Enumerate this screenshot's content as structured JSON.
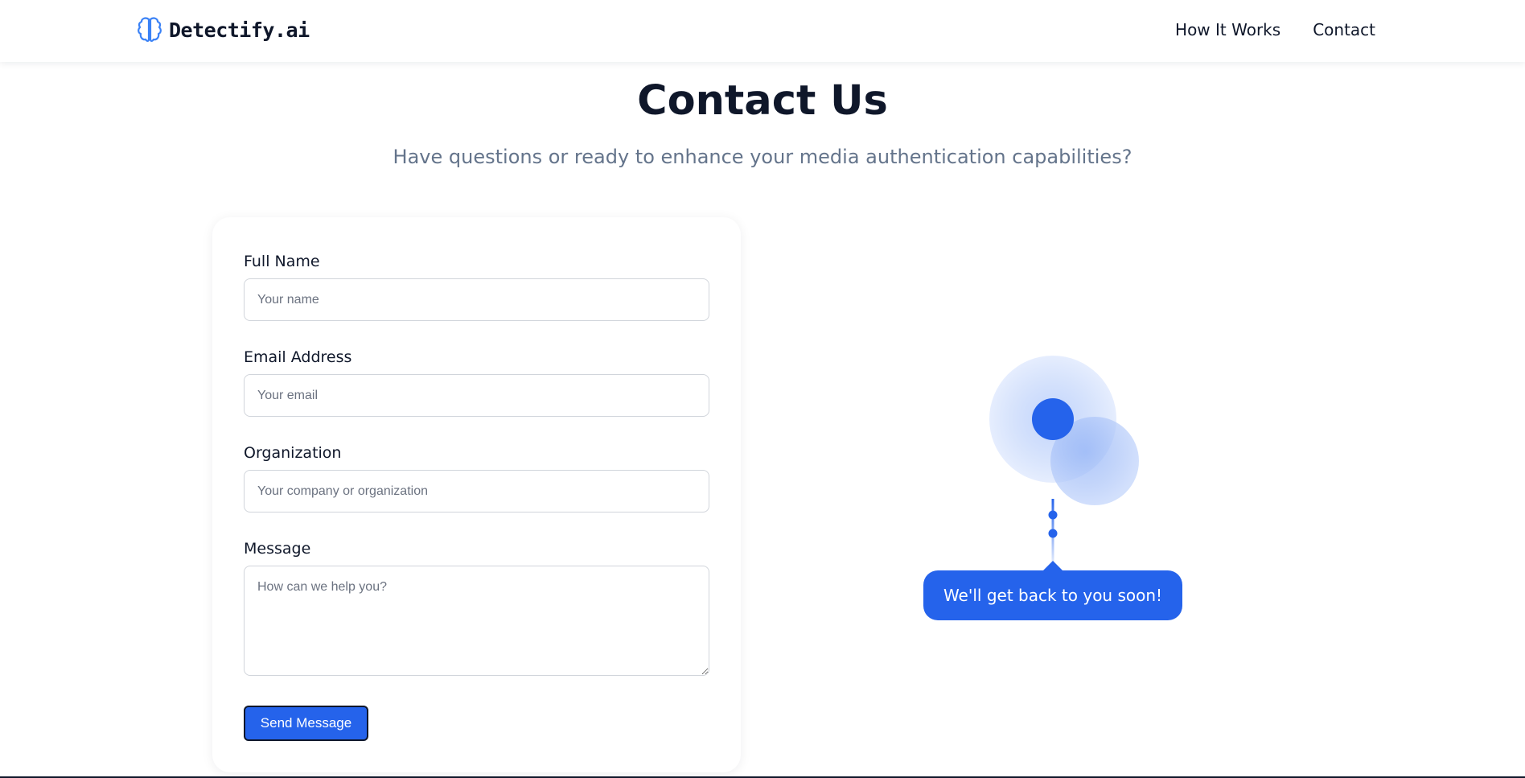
{
  "brand": {
    "name": "Detectify.ai",
    "icon": "brain-icon",
    "accent": "#3b82f6"
  },
  "nav": {
    "items": [
      {
        "label": "How It Works"
      },
      {
        "label": "Contact"
      }
    ]
  },
  "page": {
    "title": "Contact Us",
    "subtitle": "Have questions or ready to enhance your media authentication capabilities?"
  },
  "form": {
    "full_name": {
      "label": "Full Name",
      "placeholder": "Your name",
      "value": ""
    },
    "email": {
      "label": "Email Address",
      "placeholder": "Your email",
      "value": ""
    },
    "organization": {
      "label": "Organization",
      "placeholder": "Your company or organization",
      "value": ""
    },
    "message": {
      "label": "Message",
      "placeholder": "How can we help you?",
      "value": ""
    },
    "submit_label": "Send Message"
  },
  "illustration": {
    "message": "We'll get back to you soon!",
    "icon": "chat-dots-icon"
  },
  "colors": {
    "primary": "#2563eb",
    "text": "#0f172a",
    "muted": "#64748b",
    "border": "#d1d5db"
  }
}
